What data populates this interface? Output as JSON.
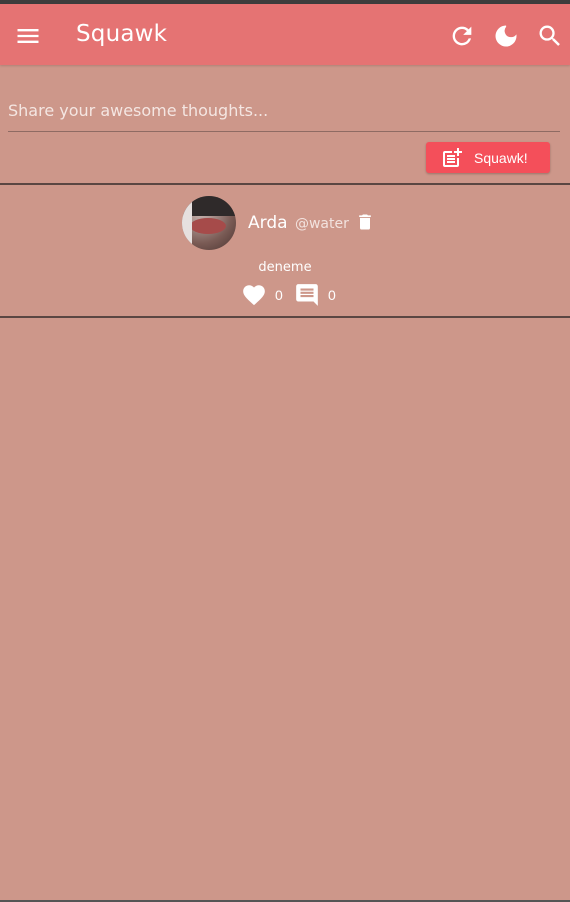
{
  "app": {
    "title": "Squawk",
    "accent_color": "#e57373",
    "background_color": "#cd978a",
    "icons": [
      "menu-icon",
      "refresh-icon",
      "dark-mode-icon",
      "search-icon"
    ]
  },
  "composer": {
    "placeholder": "Share your awesome thoughts...",
    "value": "",
    "button_label": "Squawk!",
    "button_color": "#f44f5a",
    "button_icon": "post-add-icon"
  },
  "posts": [
    {
      "author_name": "Arda",
      "author_handle": "@water",
      "content": "deneme",
      "likes": "0",
      "comments": "0",
      "icons": [
        "avatar",
        "trash-icon",
        "heart-icon",
        "comment-icon"
      ]
    }
  ]
}
